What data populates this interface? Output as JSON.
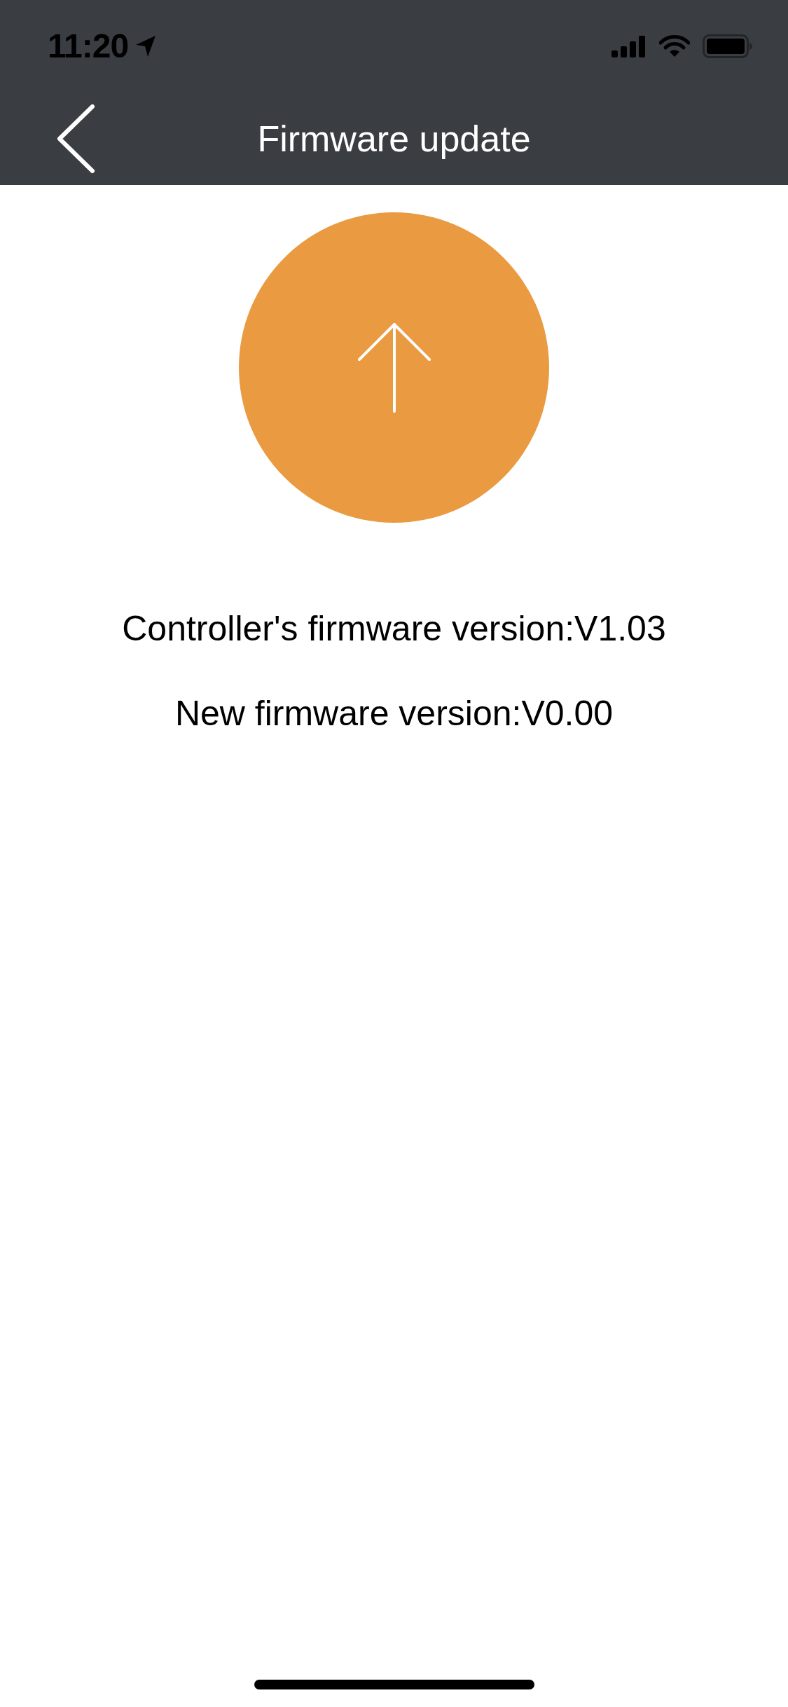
{
  "status_bar": {
    "time": "11:20"
  },
  "nav_bar": {
    "title": "Firmware update"
  },
  "firmware_info": [
    "Controller's firmware version:V1.03",
    "New firmware version:V0.00"
  ]
}
